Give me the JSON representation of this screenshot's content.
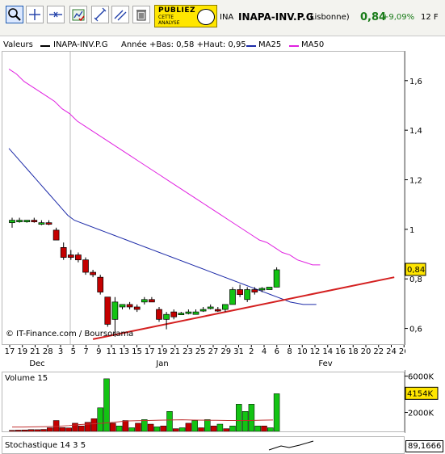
{
  "toolbar": {
    "buttons": [
      {
        "name": "zoom-tool-button",
        "icon": "magnifier-icon",
        "selected": true
      },
      {
        "name": "cursor-tool-button",
        "icon": "crosshair-icon"
      },
      {
        "name": "horizontal-line-button",
        "icon": "horizontal-line-icon"
      },
      {
        "name": "indicator-button",
        "icon": "chart-check-icon"
      },
      {
        "name": "trend-line-button",
        "icon": "trend-line-icon"
      },
      {
        "name": "parallel-lines-button",
        "icon": "parallel-lines-icon"
      },
      {
        "name": "delete-button",
        "icon": "trash-icon"
      }
    ],
    "ad": {
      "line1": "PUBLIEZ",
      "line2": "CETTE\nANALYSE"
    },
    "symbol_short": "INA",
    "symbol_full": "INAPA-INV.P.G",
    "exchange": "(Lisbonne)",
    "price": "0,84",
    "change": "+9,09%",
    "currency": "12 F"
  },
  "legend": {
    "label": "Valeurs",
    "symbol": "INAPA-INV.P.G",
    "range": "Année +Bas: 0,58 +Haut: 0,95",
    "ma25": "MA25",
    "ma50": "MA50"
  },
  "colors": {
    "up": "#13c313",
    "down": "#c40000",
    "ma25": "#1c2aa8",
    "ma50": "#e020e0",
    "trend": "#d42020",
    "volume_avg": "#c03030"
  },
  "chart_data": [
    {
      "type": "candlestick",
      "title": "",
      "credit": "© IT-Finance.com / Boursorama",
      "x_tick_labels": [
        "17",
        "19",
        "21",
        "28",
        "3",
        "5",
        "7",
        "9",
        "11",
        "13",
        "15",
        "17",
        "19",
        "21",
        "23",
        "25",
        "27",
        "29",
        "31",
        "2",
        "4",
        "6",
        "8",
        "10",
        "12",
        "14",
        "16",
        "18",
        "20",
        "22",
        "24",
        "26"
      ],
      "months": [
        "Dec",
        "Jan",
        "Fev"
      ],
      "y_ticks": [
        "0,6",
        "0,8",
        "1",
        "1,2",
        "1,4",
        "1,6"
      ],
      "ylim": [
        0.54,
        1.72
      ],
      "last_price_label": "0,84",
      "last_price": 0.84,
      "candles": [
        {
          "date": "17 Dec",
          "o": 1.03,
          "h": 1.05,
          "l": 1.01,
          "c": 1.04
        },
        {
          "date": "18 Dec",
          "o": 1.04,
          "h": 1.05,
          "l": 1.03,
          "c": 1.04
        },
        {
          "date": "19 Dec",
          "o": 1.04,
          "h": 1.04,
          "l": 1.03,
          "c": 1.04
        },
        {
          "date": "20 Dec",
          "o": 1.04,
          "h": 1.05,
          "l": 1.03,
          "c": 1.035
        },
        {
          "date": "21 Dec",
          "o": 1.03,
          "h": 1.04,
          "l": 1.02,
          "c": 1.03
        },
        {
          "date": "27 Dec",
          "o": 1.03,
          "h": 1.04,
          "l": 1.02,
          "c": 1.025
        },
        {
          "date": "28 Dec",
          "o": 1.0,
          "h": 1.01,
          "l": 0.96,
          "c": 0.96
        },
        {
          "date": "2 Jan",
          "o": 0.93,
          "h": 0.95,
          "l": 0.88,
          "c": 0.89
        },
        {
          "date": "3 Jan",
          "o": 0.9,
          "h": 0.92,
          "l": 0.88,
          "c": 0.89
        },
        {
          "date": "4 Jan",
          "o": 0.9,
          "h": 0.91,
          "l": 0.87,
          "c": 0.88
        },
        {
          "date": "7 Jan",
          "o": 0.88,
          "h": 0.89,
          "l": 0.82,
          "c": 0.83
        },
        {
          "date": "8 Jan",
          "o": 0.83,
          "h": 0.84,
          "l": 0.81,
          "c": 0.82
        },
        {
          "date": "9 Jan",
          "o": 0.81,
          "h": 0.82,
          "l": 0.74,
          "c": 0.75
        },
        {
          "date": "10 Jan",
          "o": 0.73,
          "h": 0.73,
          "l": 0.61,
          "c": 0.62
        },
        {
          "date": "11 Jan",
          "o": 0.64,
          "h": 0.73,
          "l": 0.57,
          "c": 0.71
        },
        {
          "date": "14 Jan",
          "o": 0.69,
          "h": 0.7,
          "l": 0.68,
          "c": 0.7
        },
        {
          "date": "15 Jan",
          "o": 0.7,
          "h": 0.71,
          "l": 0.68,
          "c": 0.69
        },
        {
          "date": "16 Jan",
          "o": 0.69,
          "h": 0.7,
          "l": 0.67,
          "c": 0.68
        },
        {
          "date": "17 Jan",
          "o": 0.71,
          "h": 0.73,
          "l": 0.7,
          "c": 0.72
        },
        {
          "date": "18 Jan",
          "o": 0.72,
          "h": 0.73,
          "l": 0.71,
          "c": 0.71
        },
        {
          "date": "21 Jan",
          "o": 0.68,
          "h": 0.69,
          "l": 0.63,
          "c": 0.64
        },
        {
          "date": "22 Jan",
          "o": 0.64,
          "h": 0.67,
          "l": 0.6,
          "c": 0.66
        },
        {
          "date": "23 Jan",
          "o": 0.67,
          "h": 0.68,
          "l": 0.64,
          "c": 0.65
        },
        {
          "date": "24 Jan",
          "o": 0.66,
          "h": 0.67,
          "l": 0.66,
          "c": 0.665
        },
        {
          "date": "25 Jan",
          "o": 0.665,
          "h": 0.68,
          "l": 0.66,
          "c": 0.67
        },
        {
          "date": "28 Jan",
          "o": 0.66,
          "h": 0.68,
          "l": 0.66,
          "c": 0.67
        },
        {
          "date": "29 Jan",
          "o": 0.68,
          "h": 0.69,
          "l": 0.67,
          "c": 0.68
        },
        {
          "date": "30 Jan",
          "o": 0.69,
          "h": 0.7,
          "l": 0.68,
          "c": 0.69
        },
        {
          "date": "31 Jan",
          "o": 0.68,
          "h": 0.69,
          "l": 0.67,
          "c": 0.675
        },
        {
          "date": "1 Feb",
          "o": 0.68,
          "h": 0.7,
          "l": 0.67,
          "c": 0.7
        },
        {
          "date": "4 Feb",
          "o": 0.7,
          "h": 0.77,
          "l": 0.7,
          "c": 0.76
        },
        {
          "date": "5 Feb",
          "o": 0.76,
          "h": 0.78,
          "l": 0.73,
          "c": 0.74
        },
        {
          "date": "6 Feb",
          "o": 0.72,
          "h": 0.77,
          "l": 0.71,
          "c": 0.76
        },
        {
          "date": "7 Feb",
          "o": 0.76,
          "h": 0.77,
          "l": 0.74,
          "c": 0.75
        },
        {
          "date": "8 Feb",
          "o": 0.76,
          "h": 0.77,
          "l": 0.75,
          "c": 0.765
        },
        {
          "date": "11 Feb",
          "o": 0.76,
          "h": 0.77,
          "l": 0.76,
          "c": 0.77
        },
        {
          "date": "12 Feb",
          "o": 0.77,
          "h": 0.85,
          "l": 0.77,
          "c": 0.84
        }
      ],
      "ma25": [
        1.33,
        1.3,
        1.27,
        1.24,
        1.21,
        1.18,
        1.15,
        1.12,
        1.09,
        1.06,
        1.04,
        1.03,
        1.02,
        1.01,
        1.0,
        0.99,
        0.98,
        0.97,
        0.96,
        0.95,
        0.94,
        0.93,
        0.92,
        0.91,
        0.9,
        0.89,
        0.88,
        0.87,
        0.86,
        0.85,
        0.84,
        0.83,
        0.82,
        0.81,
        0.8,
        0.79,
        0.78,
        0.77,
        0.76,
        0.75,
        0.74,
        0.73,
        0.72,
        0.71,
        0.705,
        0.7,
        0.7,
        0.7
      ],
      "ma50": [
        1.65,
        1.63,
        1.6,
        1.58,
        1.56,
        1.54,
        1.52,
        1.49,
        1.47,
        1.44,
        1.42,
        1.4,
        1.38,
        1.36,
        1.34,
        1.32,
        1.3,
        1.28,
        1.26,
        1.24,
        1.22,
        1.2,
        1.18,
        1.16,
        1.14,
        1.12,
        1.1,
        1.08,
        1.06,
        1.04,
        1.02,
        1.0,
        0.98,
        0.96,
        0.95,
        0.93,
        0.91,
        0.9,
        0.88,
        0.87,
        0.86,
        0.86
      ],
      "trendline": [
        [
          11,
          0.56
        ],
        [
          52,
          0.81
        ]
      ]
    },
    {
      "type": "bar",
      "title": "Volume 15",
      "y_ticks": [
        "2000K",
        "4154K",
        "6000K"
      ],
      "last_volume_label": "4154K",
      "ylim": [
        0,
        6500
      ],
      "volumes": [
        120,
        140,
        160,
        200,
        190,
        220,
        400,
        1200,
        420,
        380,
        900,
        600,
        1000,
        1400,
        2600,
        5800,
        900,
        600,
        1200,
        400,
        900,
        1300,
        800,
        500,
        600,
        2200,
        300,
        400,
        900,
        1200,
        400,
        1300,
        600,
        800,
        300,
        600,
        3000,
        2200,
        3000,
        600,
        600,
        400,
        4154
      ],
      "avg": [
        480,
        480,
        500,
        520,
        560,
        640,
        760,
        820,
        900,
        1000,
        1150,
        1180,
        1200,
        1240,
        1260,
        1280,
        1250,
        1230,
        1220,
        1200,
        1200,
        1200,
        1230,
        1260
      ]
    },
    {
      "type": "line",
      "title": "Stochastique 14 3 5",
      "last_value_label": "89,1666"
    }
  ]
}
